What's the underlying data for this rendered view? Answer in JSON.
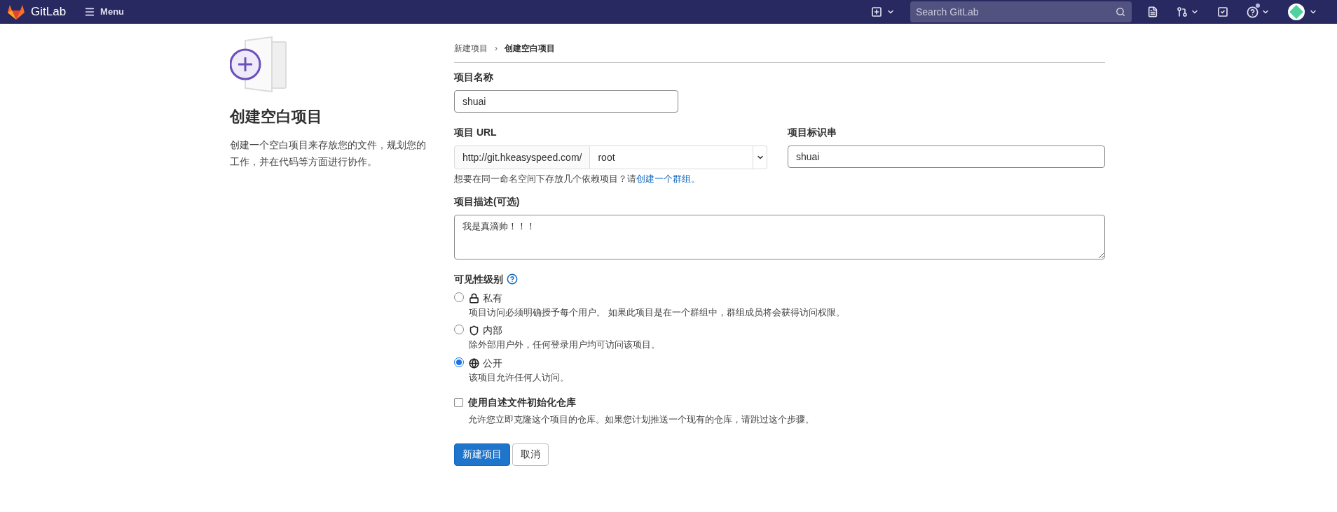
{
  "navbar": {
    "brand": "GitLab",
    "menu": "Menu",
    "search": {
      "placeholder": "Search GitLab"
    }
  },
  "intro": {
    "title": "创建空白项目",
    "description": "创建一个空白项目来存放您的文件，规划您的工作，并在代码等方面进行协作。"
  },
  "breadcrumb_separator": "›",
  "breadcrumb": [
    {
      "label": "新建项目",
      "current": false
    },
    {
      "label": "创建空白项目",
      "current": true
    }
  ],
  "project_name": {
    "label": "项目名称",
    "value": "shuai"
  },
  "project_url": {
    "label": "项目 URL",
    "prefix": "http://git.hkeasyspeed.com/",
    "namespace": "root"
  },
  "project_slug": {
    "label": "项目标识串",
    "value": "shuai"
  },
  "namespace_help": {
    "text": "想要在同一命名空间下存放几个依赖项目？请",
    "link": "创建一个群组。"
  },
  "description": {
    "label": "项目描述(可选)",
    "value": "我是真滴帅！！！"
  },
  "visibility": {
    "label": "可见性级别",
    "options": [
      {
        "kind": "lock",
        "label": "私有",
        "description": "项目访问必须明确授予每个用户。 如果此项目是在一个群组中，群组成员将会获得访问权限。",
        "selected": false
      },
      {
        "kind": "shield",
        "label": "内部",
        "description": "除外部用户外，任何登录用户均可访问该项目。",
        "selected": false
      },
      {
        "kind": "globe",
        "label": "公开",
        "description": "该项目允许任何人访问。",
        "selected": true
      }
    ]
  },
  "readme": {
    "label": "使用自述文件初始化仓库",
    "description": "允许您立即克隆这个项目的仓库。如果您计划推送一个现有的仓库，请跳过这个步骤。",
    "checked": false
  },
  "buttons": [
    {
      "kind": "primary",
      "label": "新建项目"
    },
    {
      "kind": "secondary",
      "label": "取消"
    }
  ]
}
